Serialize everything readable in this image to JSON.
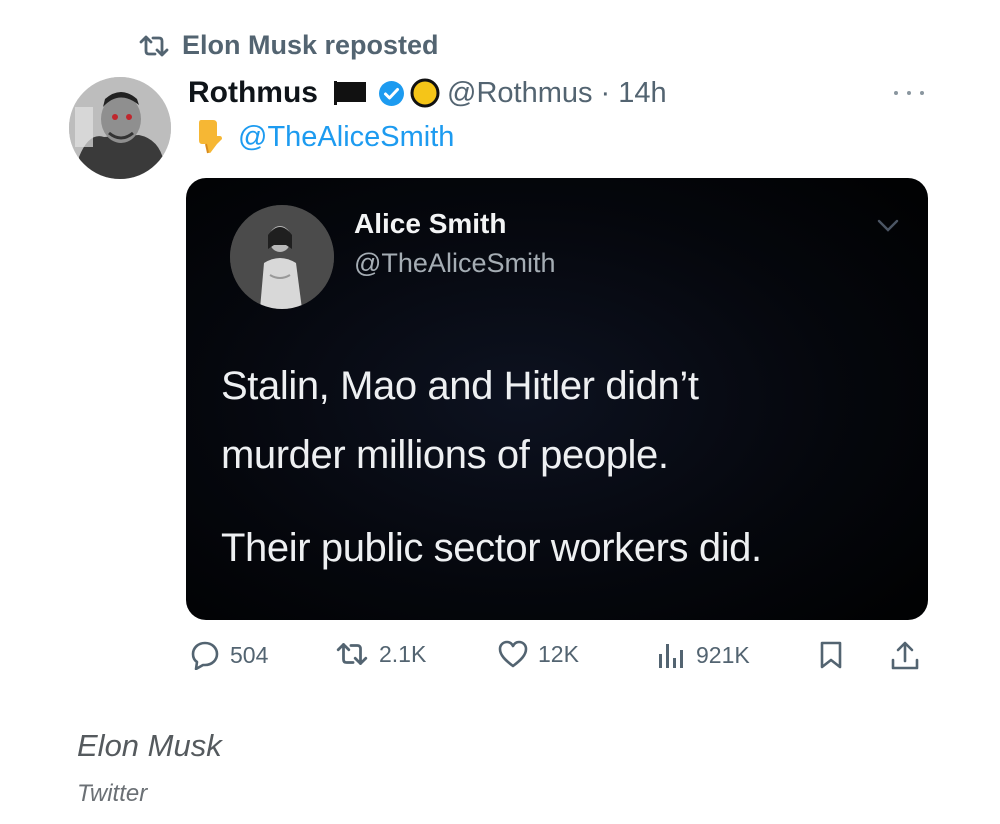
{
  "repost": {
    "label": "Elon Musk reposted",
    "icon": "repost-icon"
  },
  "post": {
    "display_name": "Rothmus",
    "handle_time": "@Rothmus · 14h",
    "mention": "@TheAliceSmith",
    "icons": [
      "black-flag-icon",
      "verified-icon",
      "gold-circle-icon",
      "pointing-down-icon",
      "more-icon"
    ]
  },
  "quoted": {
    "name": "Alice Smith",
    "handle": "@TheAliceSmith",
    "line1": "Stalin, Mao and Hitler didn’t",
    "line2": "murder millions of people.",
    "line3": "Their public sector workers did."
  },
  "actions": {
    "replies": "504",
    "reposts": "2.1K",
    "likes": "12K",
    "views": "921K"
  },
  "caption": {
    "author": "Elon Musk",
    "source": "Twitter"
  },
  "colors": {
    "accent": "#1d9bf0",
    "muted": "#536471",
    "card_bg": "#05070d"
  }
}
